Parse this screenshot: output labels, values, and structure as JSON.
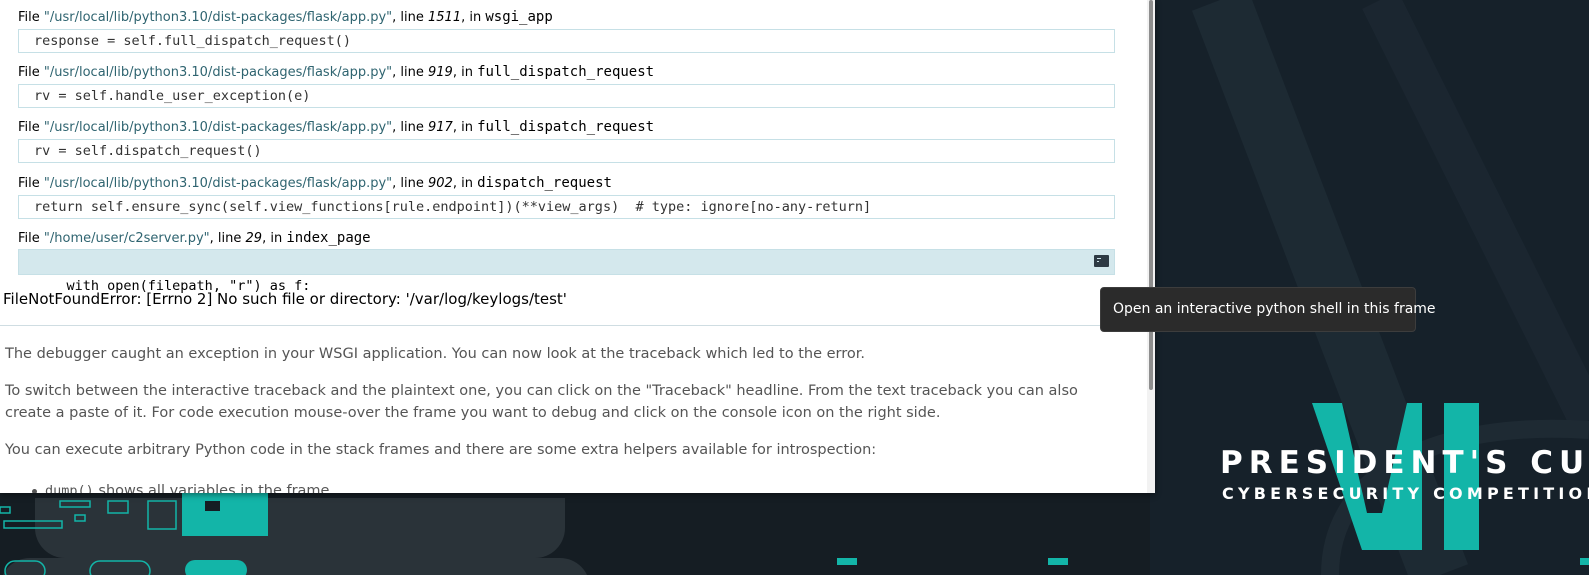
{
  "frames": [
    {
      "prefix": "File ",
      "filename": "\"/usr/local/lib/python3.10/dist-packages/flask/app.py\"",
      "line_label": ", line ",
      "lineno": "1511",
      "in_label": ", in ",
      "func": "wsgi_app",
      "code": "response = self.full_dispatch_request()"
    },
    {
      "prefix": "File ",
      "filename": "\"/usr/local/lib/python3.10/dist-packages/flask/app.py\"",
      "line_label": ", line ",
      "lineno": "919",
      "in_label": ", in ",
      "func": "full_dispatch_request",
      "code": "rv = self.handle_user_exception(e)"
    },
    {
      "prefix": "File ",
      "filename": "\"/usr/local/lib/python3.10/dist-packages/flask/app.py\"",
      "line_label": ", line ",
      "lineno": "917",
      "in_label": ", in ",
      "func": "full_dispatch_request",
      "code": "rv = self.dispatch_request()"
    },
    {
      "prefix": "File ",
      "filename": "\"/usr/local/lib/python3.10/dist-packages/flask/app.py\"",
      "line_label": ", line ",
      "lineno": "902",
      "in_label": ", in ",
      "func": "dispatch_request",
      "code": "return self.ensure_sync(self.view_functions[rule.endpoint])(**view_args)  # type: ignore[no-any-return]"
    },
    {
      "prefix": "File ",
      "filename": "\"/home/user/c2server.py\"",
      "line_label": ", line ",
      "lineno": "29",
      "in_label": ", in ",
      "func": "index_page",
      "code": "with open(filepath, \"r\") as f:"
    }
  ],
  "exception": "FileNotFoundError: [Errno 2] No such file or directory: '/var/log/keylogs/test'",
  "paragraphs": [
    "The debugger caught an exception in your WSGI application. You can now look at the traceback which led to the error.",
    "To switch between the interactive traceback and the plaintext one, you can click on the \"Traceback\" headline. From the text traceback you can also create a paste of it. For code execution mouse-over the frame you want to debug and click on the console icon on the right side.",
    "You can execute arbitrary Python code in the stack frames and there are some extra helpers available for introspection:"
  ],
  "bullet": {
    "code": "dump()",
    "text": " shows all variables in the frame"
  },
  "tooltip": "Open an interactive python shell in this frame",
  "wallpaper": {
    "title": "PRESIDENT'S CUP",
    "subtitle": "CYBERSECURITY COMPETITION",
    "accent_color": "#13b5a8",
    "background_color": "#151d23"
  },
  "colors": {
    "filename": "#2f6470",
    "current_line_bg": "#d4e8ed",
    "code_border": "#c6e0e6"
  }
}
